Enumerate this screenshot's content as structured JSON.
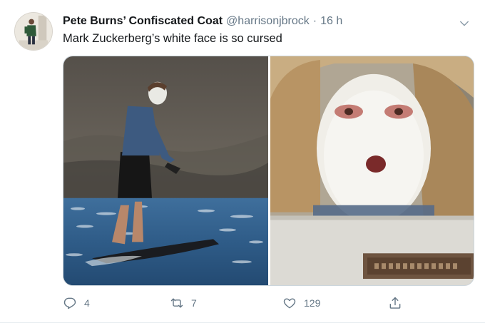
{
  "tweet": {
    "author": {
      "display_name": "Pete Burns’ Confiscated Coat",
      "handle": "@harrisonjbrock",
      "avatar_icon": "profile-avatar"
    },
    "separator": "·",
    "timestamp": "16 h",
    "text": "Mark Zuckerberg’s white face is so cursed",
    "more_icon": "chevron-down-icon",
    "media": [
      {
        "name": "surfer-photo",
        "description_icon": "photo"
      },
      {
        "name": "pie-face-photo",
        "description_icon": "photo"
      }
    ],
    "stats": {
      "replies": "4",
      "retweets": "7",
      "likes": "129"
    },
    "icons": {
      "reply": "reply-icon",
      "retweet": "retweet-icon",
      "like": "heart-icon",
      "share": "share-icon"
    },
    "colors": {
      "text_primary": "#14171a",
      "text_secondary": "#657786",
      "border": "#e6ecf0"
    }
  }
}
